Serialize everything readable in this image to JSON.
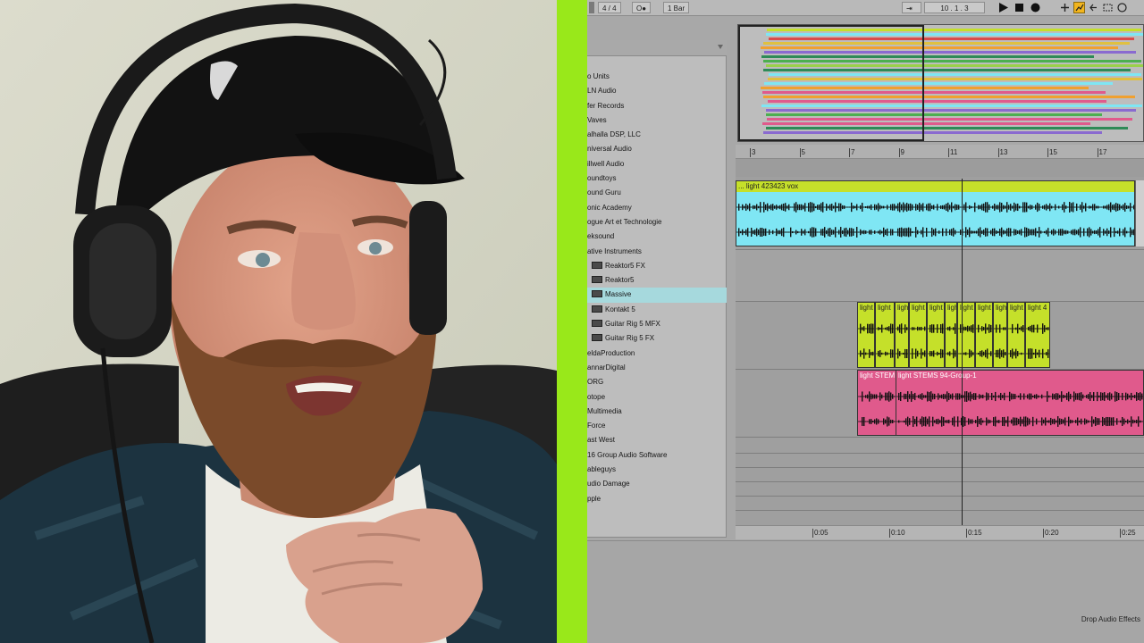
{
  "toolbar": {
    "time_signature": "4 / 4",
    "metronome": "O●",
    "quantize": "1 Bar",
    "position": "10 .   1 .   3"
  },
  "colors": {
    "accent_green": "#99e81a",
    "clip_cyan": "#7fe6f4",
    "clip_lime": "#c5e02a",
    "clip_pink": "#e05a8c",
    "selected_row": "#a6d9dd"
  },
  "browser": {
    "items": [
      {
        "label": "o Units",
        "sub": false
      },
      {
        "label": "LN Audio",
        "sub": false
      },
      {
        "label": "fer Records",
        "sub": false
      },
      {
        "label": "Vaves",
        "sub": false
      },
      {
        "label": "alhalla DSP, LLC",
        "sub": false
      },
      {
        "label": "niversal Audio",
        "sub": false
      },
      {
        "label": "illwell Audio",
        "sub": false
      },
      {
        "label": "oundtoys",
        "sub": false
      },
      {
        "label": "ound Guru",
        "sub": false
      },
      {
        "label": "onic Academy",
        "sub": false
      },
      {
        "label": "ogue Art et Technologie",
        "sub": false
      },
      {
        "label": "eksound",
        "sub": false
      },
      {
        "label": "ative Instruments",
        "sub": false
      },
      {
        "label": "Reaktor5 FX",
        "sub": true
      },
      {
        "label": "Reaktor5",
        "sub": true
      },
      {
        "label": "Massive",
        "sub": true,
        "selected": true
      },
      {
        "label": "Kontakt 5",
        "sub": true
      },
      {
        "label": "Guitar Rig 5 MFX",
        "sub": true
      },
      {
        "label": "Guitar Rig 5 FX",
        "sub": true
      },
      {
        "label": "eldaProduction",
        "sub": false
      },
      {
        "label": "annarDigital",
        "sub": false
      },
      {
        "label": "ORG",
        "sub": false
      },
      {
        "label": "otope",
        "sub": false
      },
      {
        "label": "Multimedia",
        "sub": false
      },
      {
        "label": "Force",
        "sub": false
      },
      {
        "label": "ast West",
        "sub": false
      },
      {
        "label": "16 Group Audio Software",
        "sub": false
      },
      {
        "label": "ableguys",
        "sub": false
      },
      {
        "label": "udio Damage",
        "sub": false
      },
      {
        "label": "pple",
        "sub": false
      }
    ]
  },
  "ruler": {
    "bars": [
      "3",
      "5",
      "7",
      "9",
      "11",
      "13",
      "15",
      "17"
    ]
  },
  "clips": {
    "vox": {
      "name": "... light 423423 vox"
    },
    "lime": {
      "names": [
        "light",
        "light",
        "light",
        "light",
        "light",
        "light",
        "light",
        "light",
        "light",
        "light",
        "light 4"
      ]
    },
    "pink": {
      "names": [
        "light STEM",
        "light STEMS 94-Group-1"
      ]
    }
  },
  "timeline": {
    "labels": [
      "0:05",
      "0:10",
      "0:15",
      "0:20",
      "0:25"
    ]
  },
  "status": {
    "drop_label": "Drop Audio Effects"
  }
}
